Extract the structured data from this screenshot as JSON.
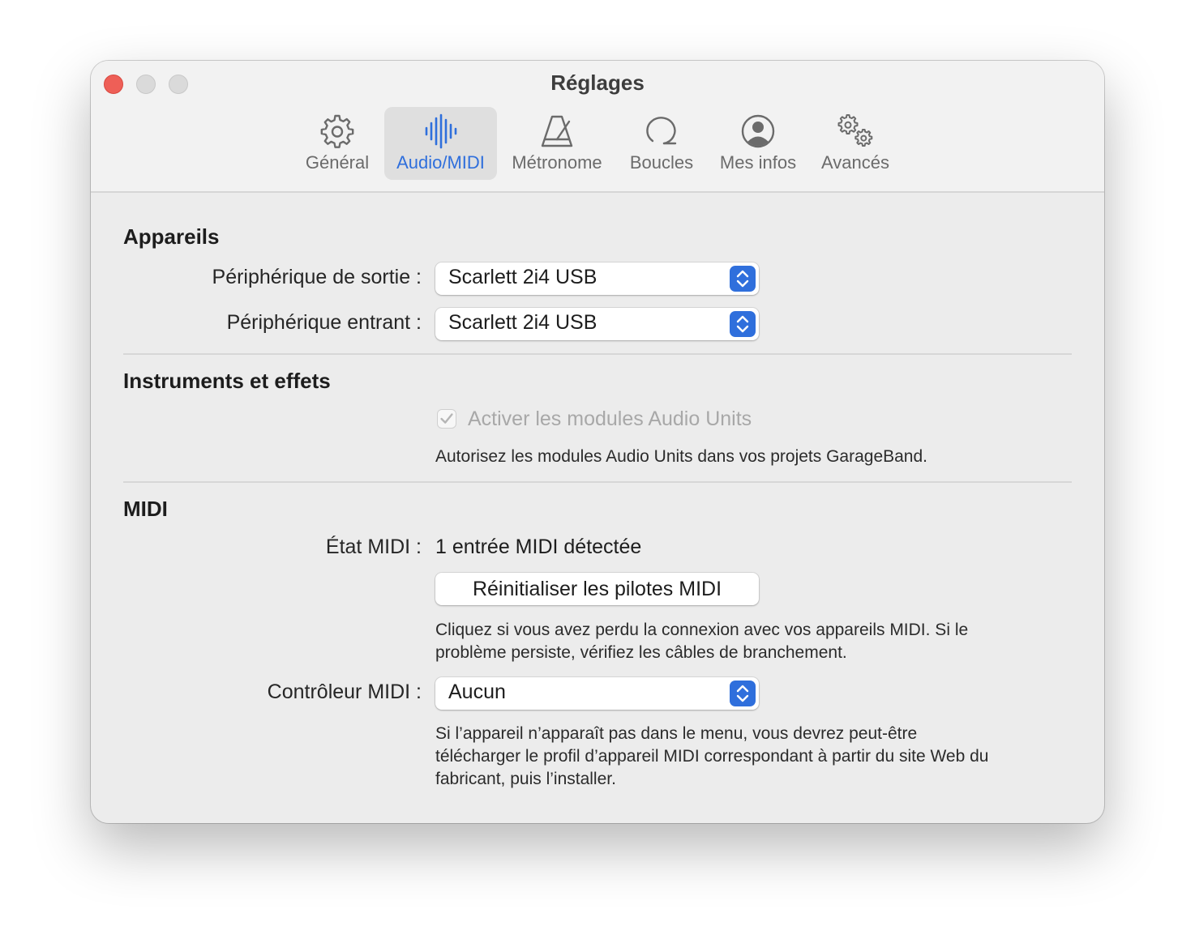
{
  "window": {
    "title": "Réglages"
  },
  "toolbar": {
    "tabs": [
      {
        "label": "Général",
        "icon": "gear-icon",
        "active": false
      },
      {
        "label": "Audio/MIDI",
        "icon": "waveform-icon",
        "active": true
      },
      {
        "label": "Métronome",
        "icon": "metronome-icon",
        "active": false
      },
      {
        "label": "Boucles",
        "icon": "loop-icon",
        "active": false
      },
      {
        "label": "Mes infos",
        "icon": "person-circle-icon",
        "active": false
      },
      {
        "label": "Avancés",
        "icon": "gears-icon",
        "active": false
      }
    ]
  },
  "devices": {
    "title": "Appareils",
    "output_label": "Périphérique de sortie :",
    "output_value": "Scarlett 2i4 USB",
    "input_label": "Périphérique entrant :",
    "input_value": "Scarlett 2i4 USB"
  },
  "instruments": {
    "title": "Instruments et effets",
    "checkbox_label": "Activer les modules Audio Units",
    "checkbox_checked": true,
    "checkbox_enabled": false,
    "help": "Autorisez les modules Audio Units dans vos projets GarageBand."
  },
  "midi": {
    "title": "MIDI",
    "status_label": "État MIDI :",
    "status_value": "1 entrée MIDI détectée",
    "reset_button": "Réinitialiser les pilotes MIDI",
    "reset_help_line1": "Cliquez si vous avez perdu la connexion avec vos appareils MIDI. Si le",
    "reset_help_line2": "problème persiste, vérifiez les câbles de branchement.",
    "controller_label": "Contrôleur MIDI :",
    "controller_value": "Aucun",
    "controller_help_line1": "Si l’appareil n’apparaît pas dans le menu, vous devrez peut-être",
    "controller_help_line2": "télécharger le profil d’appareil MIDI correspondant à partir du site Web du",
    "controller_help_line3": "fabricant, puis l’installer."
  },
  "colors": {
    "accent": "#2f6fdc",
    "close": "#ee5f57",
    "window_bg": "#ececec"
  }
}
